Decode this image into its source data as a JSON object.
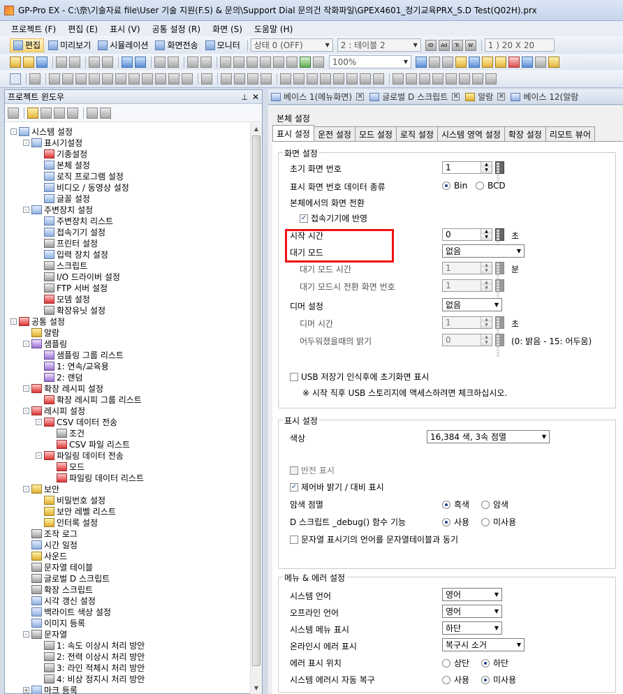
{
  "window": {
    "title": "GP-Pro EX - C:\\奈\\기술자료 file\\User 기술 지원(F.S) & 문의\\Support Dial 문의건 작화파일\\GPEX4601_정기교육PRX_S.D Test(Q02H).prx"
  },
  "menu": [
    "프로젝트 (F)",
    "편집 (E)",
    "표시 (V)",
    "공통 설정 (R)",
    "화면 (S)",
    "도움말 (H)"
  ],
  "toolbar": {
    "edit": "편집",
    "preview": "미리보기",
    "simulation": "시뮬레이션",
    "transfer": "화면전송",
    "monitor": "모니터",
    "state_combo": "상태 0 (OFF)",
    "table_combo": "2 : 테이블 2",
    "grid_combo": "1 ) 20 X 20",
    "zoom_combo": "100%",
    "id_btn": "ID",
    "ad_btn": "Ad",
    "tc_btn": "Tc",
    "w_btn": "W"
  },
  "project_window": {
    "title": "프로젝트 윈도우",
    "tree": [
      {
        "label": "시스템 설정",
        "level": 0,
        "exp": "-",
        "icon": "system-settings-icon"
      },
      {
        "label": "표시기설정",
        "level": 1,
        "exp": "-",
        "icon": "display-settings-icon"
      },
      {
        "label": "기종설정",
        "level": 2,
        "icon": "model-settings-icon"
      },
      {
        "label": "본체 설정",
        "level": 2,
        "icon": "unit-settings-icon"
      },
      {
        "label": "로직 프로그램 설정",
        "level": 2,
        "icon": "logic-program-icon"
      },
      {
        "label": "비디오 / 동영상 설정",
        "level": 2,
        "icon": "video-icon"
      },
      {
        "label": "글꼴 설정",
        "level": 2,
        "icon": "font-icon"
      },
      {
        "label": "주변장치 설정",
        "level": 1,
        "exp": "-",
        "icon": "peripheral-icon"
      },
      {
        "label": "주변장치 리스트",
        "level": 2,
        "icon": "peripheral-list-icon"
      },
      {
        "label": "접속기기 설정",
        "level": 2,
        "icon": "device-connect-icon"
      },
      {
        "label": "프린터 설정",
        "level": 2,
        "icon": "printer-icon"
      },
      {
        "label": "입력 장치 설정",
        "level": 2,
        "icon": "input-device-icon"
      },
      {
        "label": "스크립트",
        "level": 2,
        "icon": "script-icon"
      },
      {
        "label": "I/O 드라이버 설정",
        "level": 2,
        "icon": "io-driver-icon"
      },
      {
        "label": "FTP 서버 설정",
        "level": 2,
        "icon": "ftp-server-icon"
      },
      {
        "label": "모뎀 설정",
        "level": 2,
        "icon": "modem-icon"
      },
      {
        "label": "확장유닛 설정",
        "level": 2,
        "icon": "expansion-unit-icon"
      },
      {
        "label": "공통 설정",
        "level": 0,
        "exp": "-",
        "icon": "common-settings-icon"
      },
      {
        "label": "알람",
        "level": 1,
        "icon": "alarm-icon"
      },
      {
        "label": "샘플링",
        "level": 1,
        "exp": "-",
        "icon": "sampling-icon"
      },
      {
        "label": "샘플링 그룹 리스트",
        "level": 2,
        "icon": "sampling-group-icon"
      },
      {
        "label": "1: 연속/교육용",
        "level": 2,
        "icon": "sampling-item-icon"
      },
      {
        "label": "2: 랜덤",
        "level": 2,
        "icon": "sampling-item-icon"
      },
      {
        "label": "확장 레시피 설정",
        "level": 1,
        "exp": "-",
        "icon": "extended-recipe-icon"
      },
      {
        "label": "확장 레시피 그룹 리스트",
        "level": 2,
        "icon": "recipe-group-icon"
      },
      {
        "label": "레시피 설정",
        "level": 1,
        "exp": "-",
        "icon": "recipe-icon"
      },
      {
        "label": "CSV 데이터 전송",
        "level": 2,
        "exp": "-",
        "icon": "csv-transfer-icon"
      },
      {
        "label": "조건",
        "level": 3,
        "icon": "condition-icon"
      },
      {
        "label": "CSV 파일 리스트",
        "level": 3,
        "icon": "csv-file-list-icon"
      },
      {
        "label": "파일링 데이터 전송",
        "level": 2,
        "exp": "-",
        "icon": "filing-transfer-icon"
      },
      {
        "label": "모드",
        "level": 3,
        "icon": "mode-icon"
      },
      {
        "label": "파일링 데이터 리스트",
        "level": 3,
        "icon": "filing-list-icon"
      },
      {
        "label": "보안",
        "level": 1,
        "exp": "-",
        "icon": "security-key-icon"
      },
      {
        "label": "비밀번호 설정",
        "level": 2,
        "icon": "password-key-icon"
      },
      {
        "label": "보안 레벨 리스트",
        "level": 2,
        "icon": "security-level-icon"
      },
      {
        "label": "인터록 설정",
        "level": 2,
        "icon": "interlock-icon"
      },
      {
        "label": "조작 로그",
        "level": 1,
        "icon": "operation-log-icon"
      },
      {
        "label": "시간 일정",
        "level": 1,
        "icon": "time-schedule-icon"
      },
      {
        "label": "사운드",
        "level": 1,
        "icon": "sound-icon"
      },
      {
        "label": "문자열 테이블",
        "level": 1,
        "icon": "string-table-icon"
      },
      {
        "label": "글로벌 D 스크립트",
        "level": 1,
        "icon": "global-dscript-icon"
      },
      {
        "label": "확장 스크립트",
        "level": 1,
        "icon": "extended-script-icon"
      },
      {
        "label": "시각 갱신 설정",
        "level": 1,
        "icon": "time-update-icon"
      },
      {
        "label": "백라이트 색상 설정",
        "level": 1,
        "icon": "backlight-color-icon"
      },
      {
        "label": "이미지 등록",
        "level": 1,
        "icon": "image-register-icon"
      },
      {
        "label": "문자열",
        "level": 1,
        "exp": "-",
        "icon": "string-icon"
      },
      {
        "label": "1: 속도 이상시 처리 방안",
        "level": 2,
        "icon": "string-item-icon"
      },
      {
        "label": "2: 전력 이상시 처리 방안",
        "level": 2,
        "icon": "string-item-icon"
      },
      {
        "label": "3: 라인 적체시 처리 방안",
        "level": 2,
        "icon": "string-item-icon"
      },
      {
        "label": "4: 비상 정지시 처리 방안",
        "level": 2,
        "icon": "string-item-icon"
      },
      {
        "label": "마크 등록",
        "level": 1,
        "exp": "+",
        "icon": "mark-register-icon"
      }
    ]
  },
  "doc_tabs": [
    {
      "label": "베이스 1(메뉴화면)"
    },
    {
      "label": "글로벌 D 스크립트"
    },
    {
      "label": "알람"
    },
    {
      "label": "베이스 12(알람"
    }
  ],
  "unit_settings": {
    "title": "본체 설정",
    "tabs": [
      "표시 설정",
      "운전 설정",
      "모드 설정",
      "로직 설정",
      "시스템 영역 설정",
      "확장 설정",
      "리모트 뷰어"
    ],
    "screen": {
      "group": "화면 설정",
      "initial_screen_label": "초기 화면 번호",
      "initial_screen_value": "1",
      "data_type_label": "표시 화면 번호 데이터 종류",
      "bin": "Bin",
      "bcd": "BCD",
      "switch_label": "본체에서의 화면 전환",
      "reflect_label": "접속기기에 반영",
      "start_time_label": "시작 시간",
      "start_time_value": "0",
      "start_time_unit": "초",
      "standby_label": "대기 모드",
      "standby_value": "없음",
      "standby_time_label": "대기 모드 시간",
      "standby_time_value": "1",
      "standby_time_unit": "분",
      "standby_screen_label": "대기 모드시 전환 화면 번호",
      "standby_screen_value": "1",
      "dimmer_label": "디머 설정",
      "dimmer_value": "없음",
      "dimmer_time_label": "디머 시간",
      "dimmer_time_value": "1",
      "dimmer_time_unit": "초",
      "dark_label": "어두워졌을때의 밝기",
      "dark_value": "0",
      "dark_hint": "(0: 밝음 - 15: 어두움)",
      "usb_label": "USB 저장기 인식후에 초기화면 표시",
      "usb_note": "※ 시작 직후 USB 스토리지에 액세스하려면 체크하십시오."
    },
    "display": {
      "group": "표시 설정",
      "color_label": "색상",
      "color_value": "16,384 색, 3속 점멸",
      "invert_label": "반전 표시",
      "controlbar_label": "제어바 밝기 / 대비 표시",
      "blink_label": "암색 점멸",
      "black": "흑색",
      "dark": "암색",
      "debug_label": "D 스크립트 _debug() 함수 기능",
      "use": "사용",
      "unused": "미사용",
      "sync_label": "문자열 표시기의 언어를 문자열테이블과 동기"
    },
    "menu_error": {
      "group": "메뉴 & 에러 설정",
      "sys_lang_label": "시스템 언어",
      "sys_lang_value": "영어",
      "offline_lang_label": "오프라인 언어",
      "offline_lang_value": "영어",
      "sys_menu_label": "시스템 메뉴 표시",
      "sys_menu_value": "하단",
      "online_err_label": "온라인시 에러 표시",
      "online_err_value": "복구시 소거",
      "err_pos_label": "에러 표시 위치",
      "top": "상단",
      "bottom": "하단",
      "auto_recover_label": "시스템 에러시 자동 복구",
      "use": "사용",
      "unused": "미사용"
    }
  }
}
